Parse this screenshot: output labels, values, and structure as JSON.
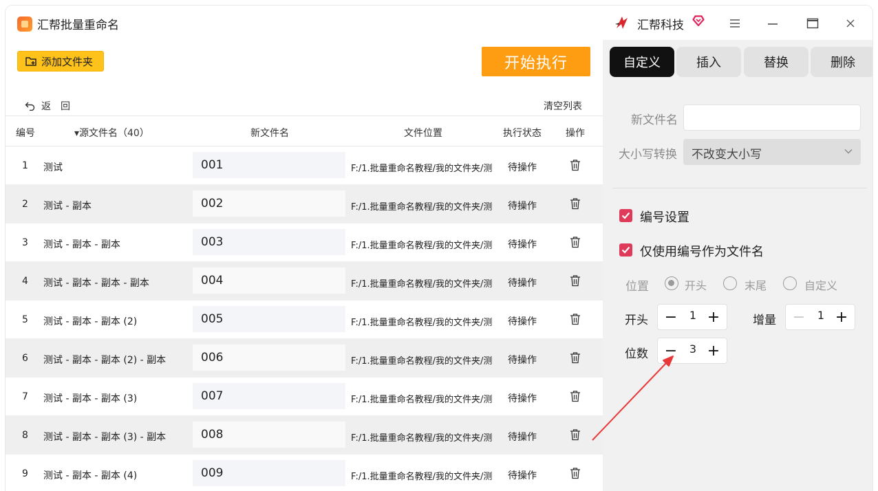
{
  "app": {
    "title": "汇帮批量重命名",
    "brand_name": "汇帮科技"
  },
  "toolbar": {
    "add_folder_label": "添加文件夹",
    "start_label": "开始执行",
    "back_label": "返回",
    "clear_label": "清空列表"
  },
  "table": {
    "headers": {
      "idx": "编号",
      "source": "▾源文件名（40）",
      "new_name": "新文件名",
      "location": "文件位置",
      "status": "执行状态",
      "action": "操作"
    },
    "rows": [
      {
        "idx": "1",
        "source": "测试",
        "new_name": "001",
        "path": "F:/1.批量重命名教程/我的文件夹/测",
        "status": "待操作"
      },
      {
        "idx": "2",
        "source": "测试 - 副本",
        "new_name": "002",
        "path": "F:/1.批量重命名教程/我的文件夹/测",
        "status": "待操作"
      },
      {
        "idx": "3",
        "source": "测试 - 副本 - 副本",
        "new_name": "003",
        "path": "F:/1.批量重命名教程/我的文件夹/测",
        "status": "待操作"
      },
      {
        "idx": "4",
        "source": "测试 - 副本 - 副本 - 副本",
        "new_name": "004",
        "path": "F:/1.批量重命名教程/我的文件夹/测",
        "status": "待操作"
      },
      {
        "idx": "5",
        "source": "测试 - 副本 - 副本 (2)",
        "new_name": "005",
        "path": "F:/1.批量重命名教程/我的文件夹/测",
        "status": "待操作"
      },
      {
        "idx": "6",
        "source": "测试 - 副本 - 副本 (2) - 副本",
        "new_name": "006",
        "path": "F:/1.批量重命名教程/我的文件夹/测",
        "status": "待操作"
      },
      {
        "idx": "7",
        "source": "测试 - 副本 - 副本 (3)",
        "new_name": "007",
        "path": "F:/1.批量重命名教程/我的文件夹/测",
        "status": "待操作"
      },
      {
        "idx": "8",
        "source": "测试 - 副本 - 副本 (3) - 副本",
        "new_name": "008",
        "path": "F:/1.批量重命名教程/我的文件夹/测",
        "status": "待操作"
      },
      {
        "idx": "9",
        "source": "测试 - 副本 - 副本 (4)",
        "new_name": "009",
        "path": "F:/1.批量重命名教程/我的文件夹/测",
        "status": "待操作"
      }
    ]
  },
  "panel": {
    "tabs": [
      "自定义",
      "插入",
      "替换",
      "删除"
    ],
    "active_tab": "自定义",
    "new_name_label": "新文件名",
    "new_name_value": "",
    "case_label": "大小写转换",
    "case_value": "不改变大小写",
    "numbering_label": "编号设置",
    "numbering_checked": true,
    "only_number_label": "仅使用编号作为文件名",
    "only_number_checked": true,
    "position_label": "位置",
    "position_options": [
      "开头",
      "末尾",
      "自定义"
    ],
    "position_selected": "开头",
    "start_label": "开头",
    "start_value": "1",
    "increment_label": "增量",
    "increment_value": "1",
    "digits_label": "位数",
    "digits_value": "3"
  },
  "colors": {
    "accent_orange": "#ff9d12",
    "add_button_yellow": "#ffc21a",
    "checkbox_red": "#e03a5a",
    "annotation_arrow": "#e8393a"
  }
}
